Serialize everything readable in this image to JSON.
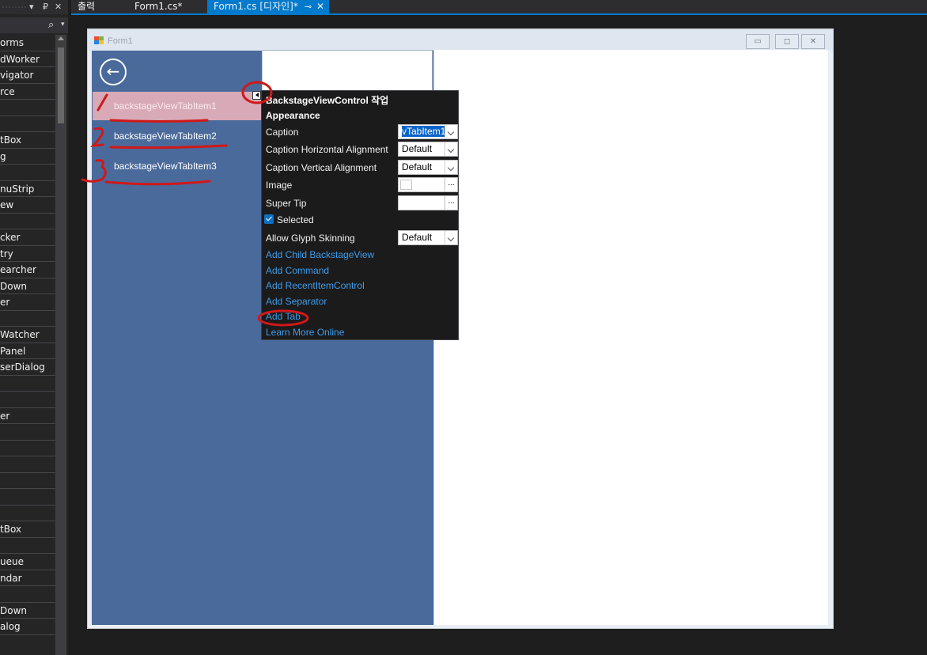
{
  "toolbox": {
    "items": [
      {
        "label": "orms"
      },
      {
        "label": "dWorker"
      },
      {
        "label": "vigator"
      },
      {
        "label": "rce"
      },
      {
        "label": ""
      },
      {
        "label": ""
      },
      {
        "label": "tBox"
      },
      {
        "label": "g"
      },
      {
        "label": ""
      },
      {
        "label": "nuStrip"
      },
      {
        "label": "ew"
      },
      {
        "label": ""
      },
      {
        "label": "cker"
      },
      {
        "label": "try"
      },
      {
        "label": "earcher"
      },
      {
        "label": "Down"
      },
      {
        "label": "er"
      },
      {
        "label": ""
      },
      {
        "label": "Watcher"
      },
      {
        "label": "Panel"
      },
      {
        "label": "serDialog"
      },
      {
        "label": ""
      },
      {
        "label": ""
      },
      {
        "label": "er"
      },
      {
        "label": ""
      },
      {
        "label": ""
      },
      {
        "label": ""
      },
      {
        "label": ""
      },
      {
        "label": ""
      },
      {
        "label": ""
      },
      {
        "label": "tBox"
      },
      {
        "label": ""
      },
      {
        "label": "ueue"
      },
      {
        "label": "ndar"
      },
      {
        "label": ""
      },
      {
        "label": "Down"
      },
      {
        "label": "alog"
      }
    ],
    "search_icon": "search-icon",
    "controls": {
      "dropdown": "▾",
      "pin": "₽",
      "close": "✕"
    }
  },
  "tabs": [
    {
      "label": "출력",
      "active": false
    },
    {
      "label": "Form1.cs*",
      "active": false
    },
    {
      "label": "Form1.cs [디자인]*",
      "active": true,
      "pin": "⊸",
      "close": "✕"
    }
  ],
  "form": {
    "title": "Form1",
    "buttons": {
      "minimize": "▭",
      "maximize": "◻",
      "close": "✕"
    }
  },
  "backstage": {
    "back_icon": "←",
    "tabs": [
      {
        "label": "backstageViewTabItem1",
        "selected": true
      },
      {
        "label": "backstageViewTabItem2",
        "selected": false
      },
      {
        "label": "backstageViewTabItem3",
        "selected": false
      }
    ]
  },
  "tasks_panel": {
    "title": "BackstageViewControl 작업",
    "section": "Appearance",
    "properties": {
      "caption": {
        "label": "Caption",
        "value": "vTabItem1"
      },
      "caption_h_align": {
        "label": "Caption Horizontal Alignment",
        "value": "Default"
      },
      "caption_v_align": {
        "label": "Caption Vertical Alignment",
        "value": "Default"
      },
      "image": {
        "label": "Image",
        "button": "..."
      },
      "super_tip": {
        "label": "Super Tip",
        "button": "..."
      },
      "selected": {
        "label": "Selected",
        "checked": true
      },
      "allow_glyph_skinning": {
        "label": "Allow Glyph Skinning",
        "value": "Default"
      }
    },
    "links": [
      "Add Child BackstageView",
      "Add Command",
      "Add RecentItemControl",
      "Add Separator",
      "Add Tab",
      "Learn More Online"
    ]
  },
  "annotations": {
    "numbers": [
      "1",
      "2",
      "3"
    ],
    "color": "#d01818"
  },
  "colors": {
    "accent": "#007acc",
    "backstage_bg": "#4a6a9b",
    "selected_tab": "#d8aab7",
    "link": "#3e9ce9"
  }
}
